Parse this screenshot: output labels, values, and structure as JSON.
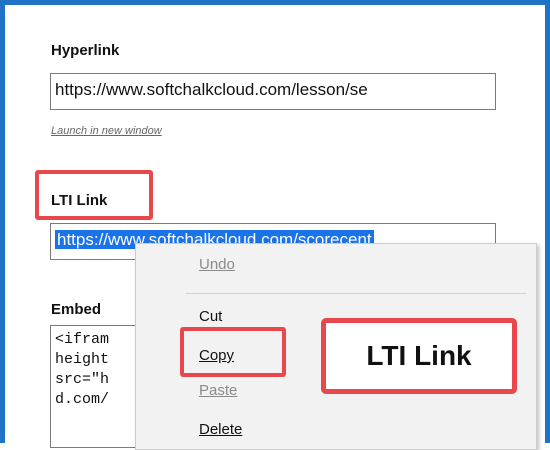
{
  "hyperlink": {
    "label": "Hyperlink",
    "value": "https://www.softchalkcloud.com/lesson/se",
    "launch_link": "Launch in new window"
  },
  "lti_link": {
    "label": "LTI Link",
    "value": "https://www.softchalkcloud.com/scorecent"
  },
  "embed": {
    "label": "Embed",
    "lines": [
      "<ifram",
      "height",
      "src=\"h",
      "d.com/",
      ""
    ]
  },
  "context_menu": {
    "items": [
      {
        "label": "Undo",
        "enabled": false
      },
      {
        "label": "Cut",
        "enabled": true
      },
      {
        "label": "Copy",
        "enabled": true
      },
      {
        "label": "Paste",
        "enabled": false
      },
      {
        "label": "Delete",
        "enabled": true
      }
    ]
  },
  "callout": {
    "text": "LTI Link"
  },
  "colors": {
    "frame_border": "#1f72c4",
    "highlight_red": "#e8484b",
    "selection_blue": "#1a73e8"
  }
}
